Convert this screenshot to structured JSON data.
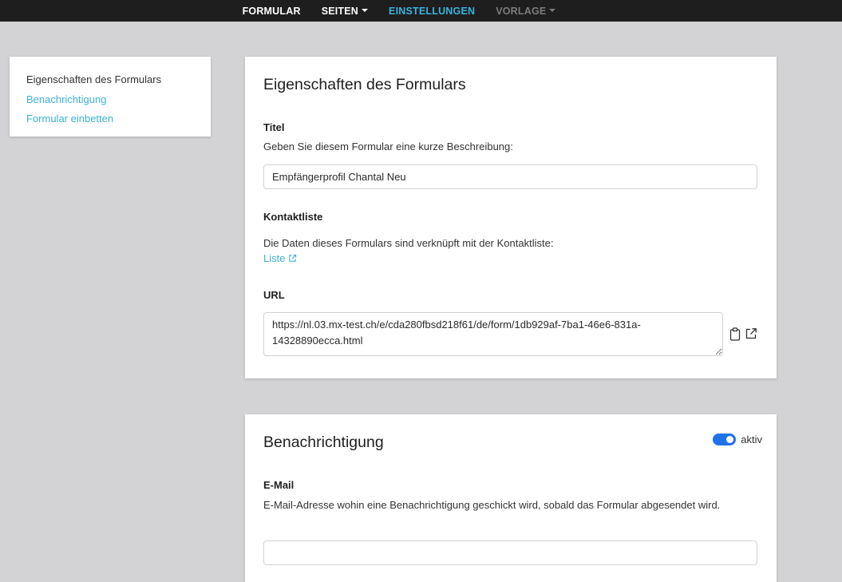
{
  "nav": {
    "items": [
      {
        "label": "FORMULAR",
        "state": "normal"
      },
      {
        "label": "SEITEN",
        "state": "dropdown"
      },
      {
        "label": "EINSTELLUNGEN",
        "state": "active"
      },
      {
        "label": "VORLAGE",
        "state": "disabled-dropdown"
      }
    ]
  },
  "sidebar": {
    "items": [
      {
        "label": "Eigenschaften des Formulars"
      },
      {
        "label": "Benachrichtigung"
      },
      {
        "label": "Formular einbetten"
      }
    ]
  },
  "properties": {
    "title": "Eigenschaften des Formulars",
    "titel_label": "Titel",
    "titel_help": "Geben Sie diesem Formular eine kurze Beschreibung:",
    "titel_value": "Empfängerprofil Chantal Neu",
    "kontakt_label": "Kontaktliste",
    "kontakt_help": "Die Daten dieses Formulars sind verknüpft mit der Kontaktliste:",
    "kontakt_link": "Liste",
    "url_label": "URL",
    "url_value": "https://nl.03.mx-test.ch/e/cda280fbsd218f61/de/form/1db929af-7ba1-46e6-831a-14328890ecca.html"
  },
  "notification": {
    "title": "Benachrichtigung",
    "toggle_label": "aktiv",
    "toggle_on": true,
    "email_label": "E-Mail",
    "email_help": "E-Mail-Adresse wohin eine Benachrichtigung geschickt wird, sobald das Formular abgesendet wird.",
    "email_value": ""
  },
  "colors": {
    "accent": "#39b3dd",
    "link": "#3fb1d4",
    "toggle": "#1f73e8",
    "nav_bg": "#1e1e1e",
    "page_bg": "#d3d3d5"
  }
}
